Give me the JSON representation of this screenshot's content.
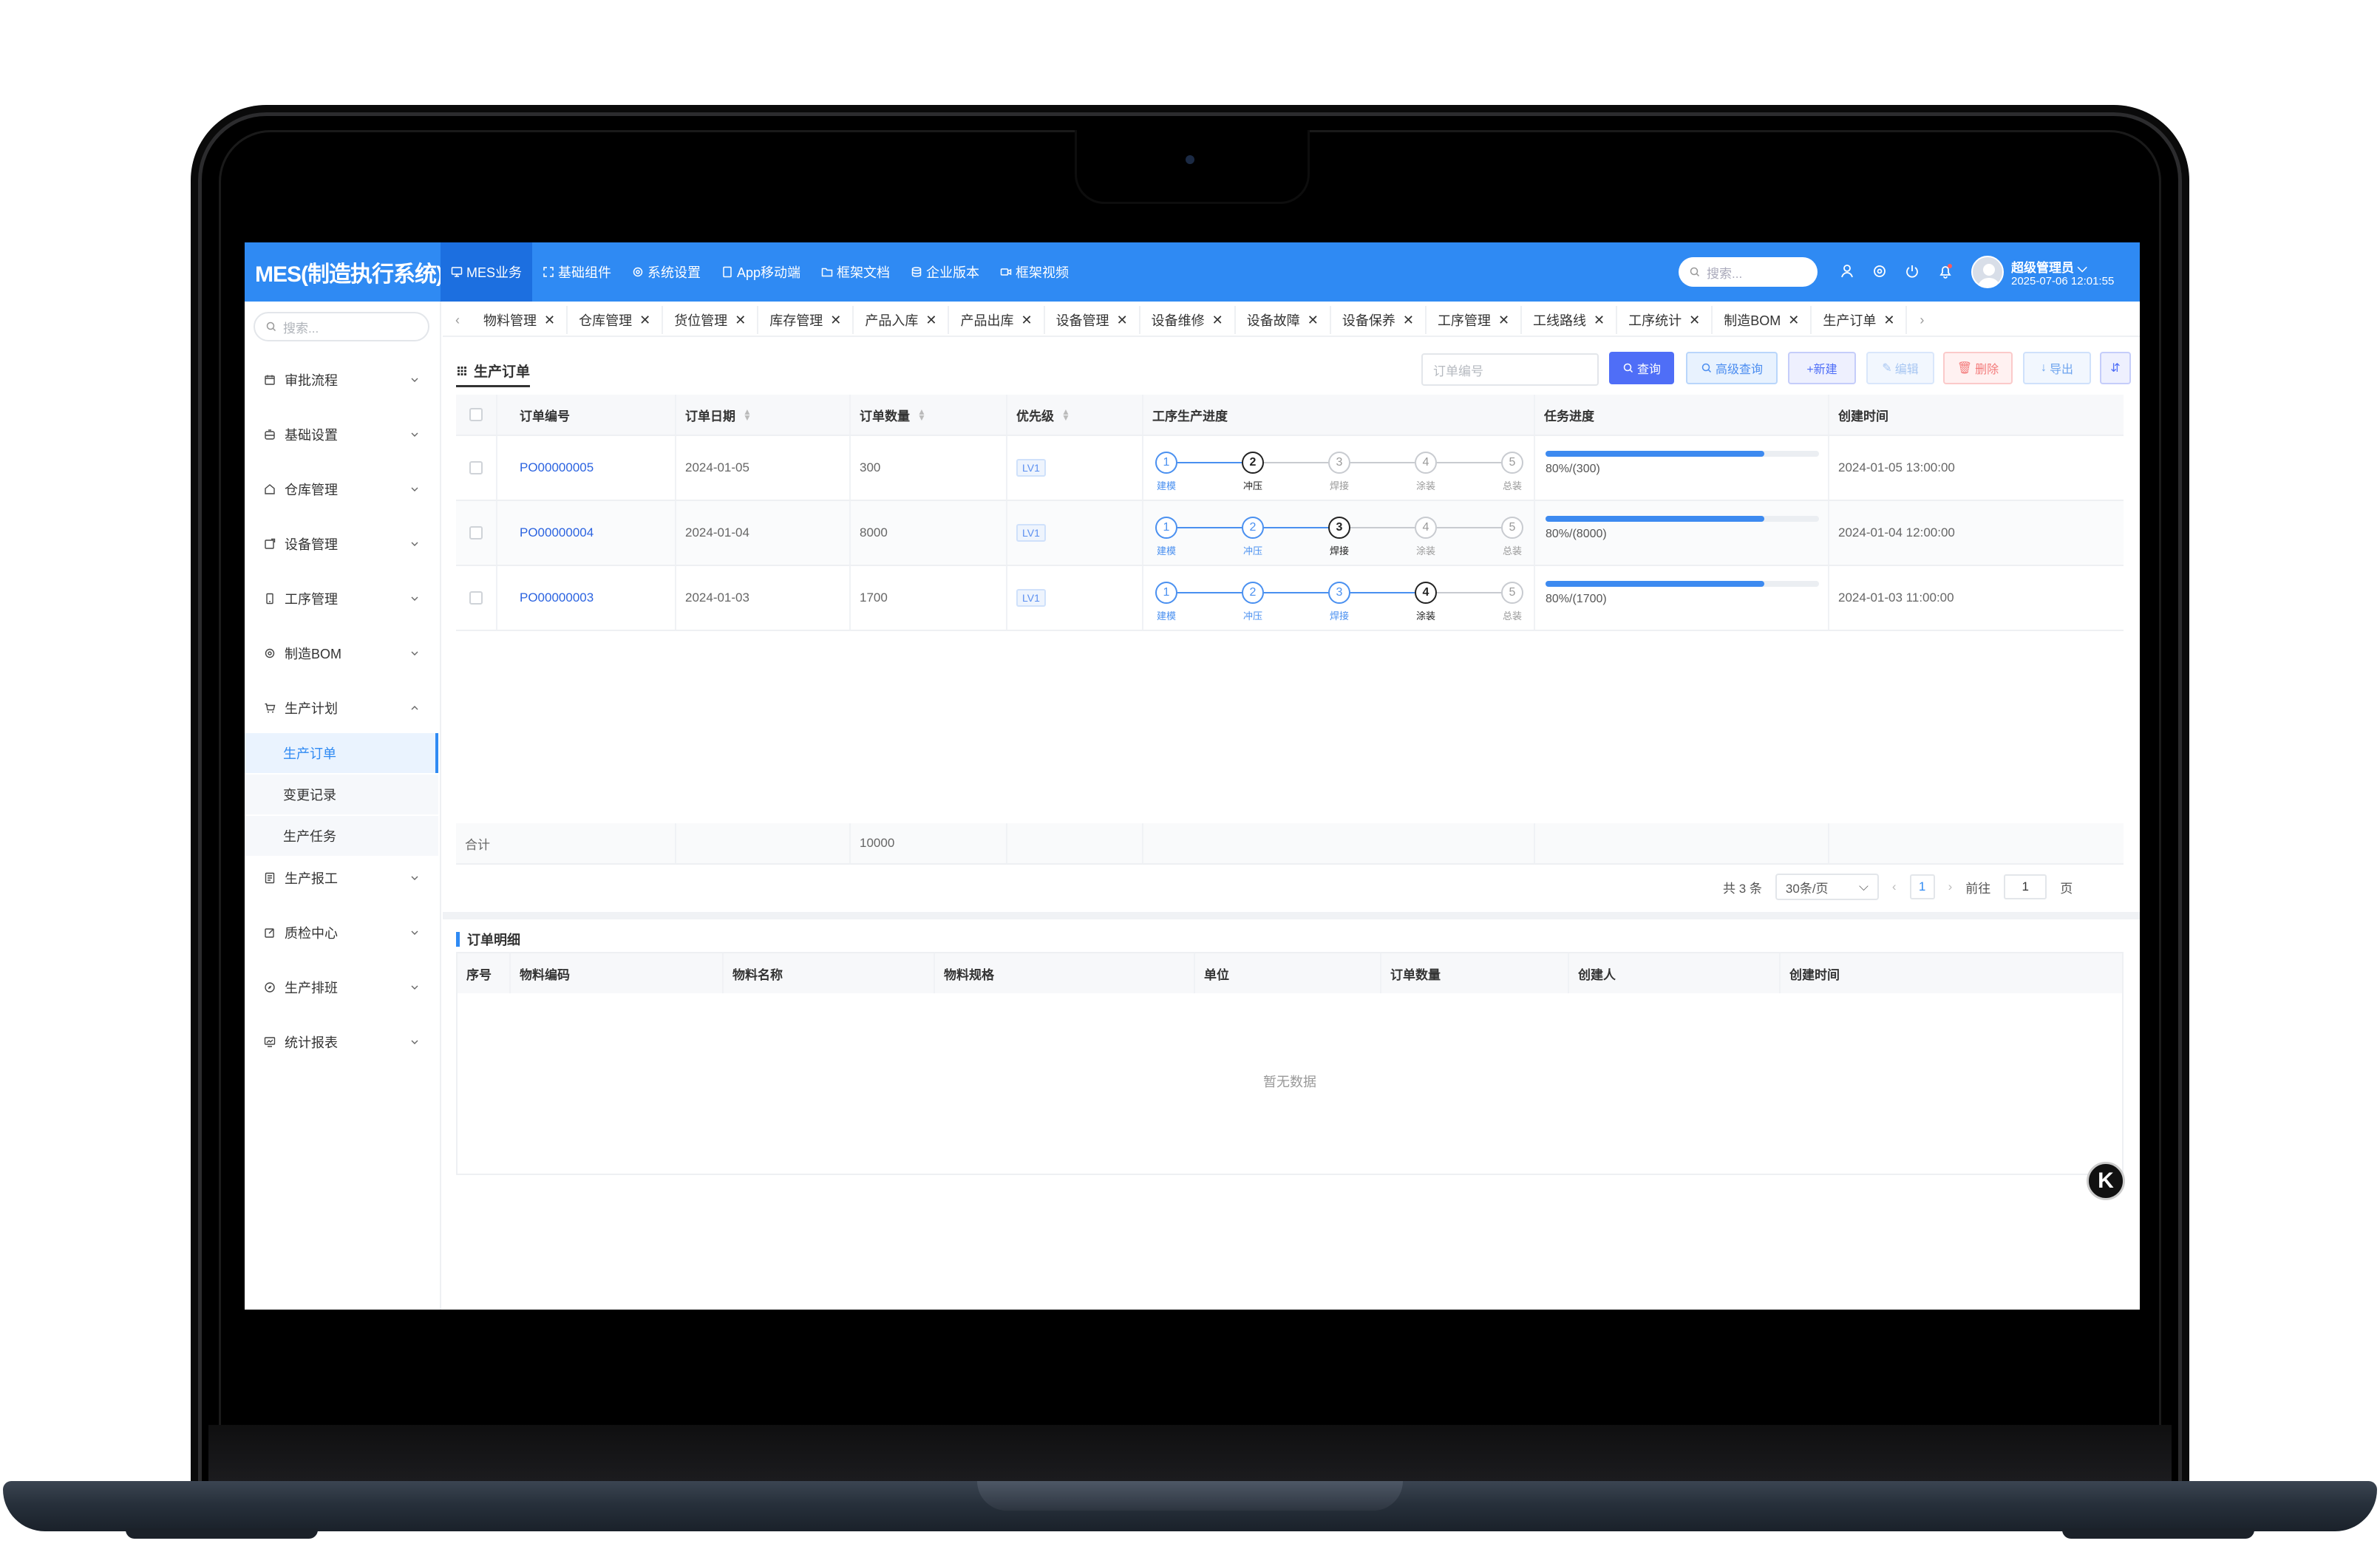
{
  "app": {
    "title": "MES(制造执行系统)"
  },
  "topnav": [
    {
      "label": "MES业务",
      "icon": "monitor-icon"
    },
    {
      "label": "基础组件",
      "icon": "expand-icon"
    },
    {
      "label": "系统设置",
      "icon": "gear-icon"
    },
    {
      "label": "App移动端",
      "icon": "tablet-icon"
    },
    {
      "label": "框架文档",
      "icon": "folder-icon"
    },
    {
      "label": "企业版本",
      "icon": "database-icon"
    },
    {
      "label": "框架视频",
      "icon": "video-icon"
    }
  ],
  "header": {
    "search_placeholder": "搜索...",
    "user_name": "超级管理员",
    "user_time": "2025-07-06 12:01:55"
  },
  "sidebar": {
    "search_placeholder": "搜索...",
    "items": [
      {
        "label": "审批流程",
        "icon": "calendar-icon"
      },
      {
        "label": "基础设置",
        "icon": "cabinet-icon"
      },
      {
        "label": "仓库管理",
        "icon": "home-icon"
      },
      {
        "label": "设备管理",
        "icon": "device-icon"
      },
      {
        "label": "工序管理",
        "icon": "phone-icon"
      },
      {
        "label": "制造BOM",
        "icon": "cog-icon"
      },
      {
        "label": "生产计划",
        "icon": "cart-icon"
      },
      {
        "label": "生产报工",
        "icon": "document-icon"
      },
      {
        "label": "质检中心",
        "icon": "edit-icon"
      },
      {
        "label": "生产排班",
        "icon": "compass-icon"
      },
      {
        "label": "统计报表",
        "icon": "chart-icon"
      }
    ],
    "subitems": [
      "生产订单",
      "变更记录",
      "生产任务"
    ]
  },
  "tabs": [
    "物料管理",
    "仓库管理",
    "货位管理",
    "库存管理",
    "产品入库",
    "产品出库",
    "设备管理",
    "设备维修",
    "设备故障",
    "设备保养",
    "工序管理",
    "工线路线",
    "工序统计",
    "制造BOM",
    "生产订单"
  ],
  "panel": {
    "title": "生产订单",
    "search_placeholder": "订单编号",
    "btn_query": "查询",
    "btn_adv": "高级查询",
    "btn_new": "+新建",
    "btn_edit": "编辑",
    "btn_del": "删除",
    "btn_export": "导出"
  },
  "table": {
    "headers": [
      "订单编号",
      "订单日期",
      "订单数量",
      "优先级",
      "工序生产进度",
      "任务进度",
      "创建时间"
    ],
    "step_labels": [
      "建模",
      "冲压",
      "焊接",
      "涂装",
      "总装"
    ],
    "rows": [
      {
        "order_no": "PO00000005",
        "date": "2024-01-05",
        "qty": "300",
        "priority": "LV1",
        "current_step": 2,
        "progress": 0.8,
        "progress_text": "80%/(300)",
        "created": "2024-01-05 13:00:00"
      },
      {
        "order_no": "PO00000004",
        "date": "2024-01-04",
        "qty": "8000",
        "priority": "LV1",
        "current_step": 3,
        "progress": 0.8,
        "progress_text": "80%/(8000)",
        "created": "2024-01-04 12:00:00"
      },
      {
        "order_no": "PO00000003",
        "date": "2024-01-03",
        "qty": "1700",
        "priority": "LV1",
        "current_step": 4,
        "progress": 0.8,
        "progress_text": "80%/(1700)",
        "created": "2024-01-03 11:00:00"
      }
    ],
    "footer_label": "合计",
    "footer_qty": "10000"
  },
  "pager": {
    "total": "共 3 条",
    "page_size": "30条/页",
    "current": "1",
    "goto_label": "前往",
    "goto_value": "1",
    "page_unit": "页"
  },
  "detail": {
    "title": "订单明细",
    "headers": [
      "序号",
      "物料编码",
      "物料名称",
      "物料规格",
      "单位",
      "订单数量",
      "创建人",
      "创建时间"
    ],
    "empty": "暂无数据"
  },
  "float_button": {
    "label": "K"
  }
}
